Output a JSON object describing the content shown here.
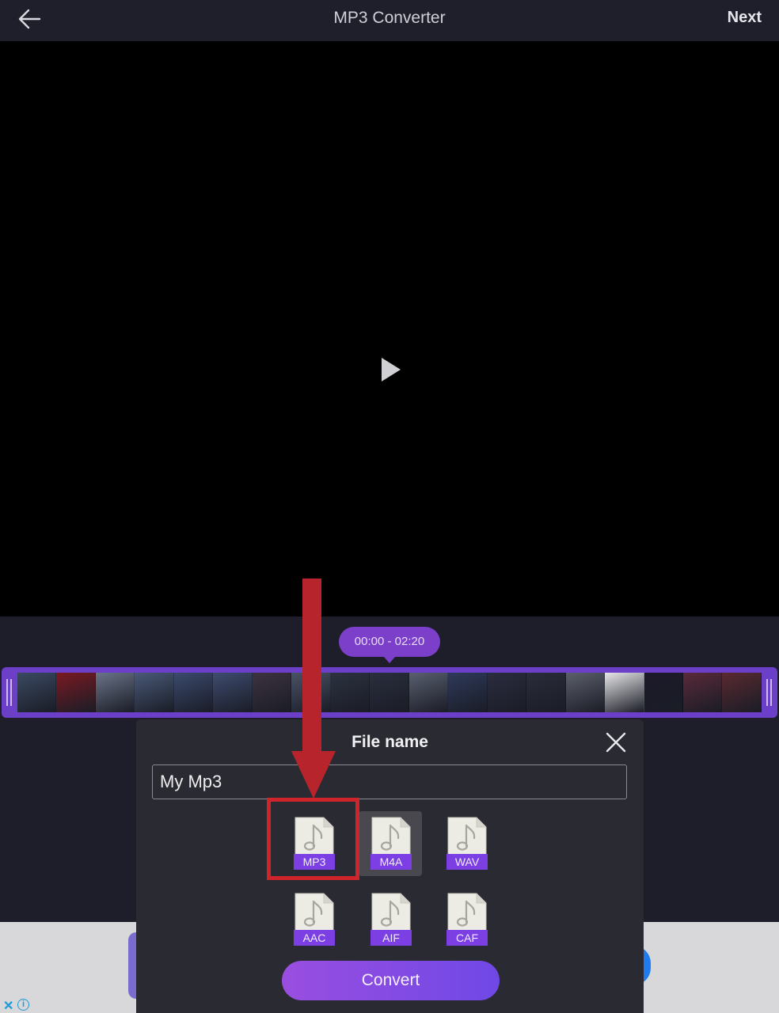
{
  "header": {
    "back_icon": "back-arrow-icon",
    "title": "MP3 Converter",
    "next_label": "Next"
  },
  "video": {
    "play_icon": "play-icon"
  },
  "timeline": {
    "range_label": "00:00 - 02:20",
    "frame_colors": [
      "#3a4a62",
      "#7a1a22",
      "#6a7488",
      "#4a5a78",
      "#3b4a6e",
      "#3e4c70",
      "#3d3340",
      "#4a5266",
      "#2c3240",
      "#2a2f3e",
      "#5a6070",
      "#2e3a5a",
      "#2b2d40",
      "#2a2c3a",
      "#5c606a",
      "#e7e7e9",
      "#1c1a2a",
      "#5a2a3a",
      "#5a2a30"
    ],
    "accent": "#6b3fc8"
  },
  "dialog": {
    "title": "File name",
    "close_icon": "close-icon",
    "file_name_value": "My Mp3",
    "formats": [
      {
        "label": "MP3",
        "selected": false
      },
      {
        "label": "M4A",
        "selected": true
      },
      {
        "label": "WAV",
        "selected": false
      },
      {
        "label": "AAC",
        "selected": false
      },
      {
        "label": "AIF",
        "selected": false
      },
      {
        "label": "CAF",
        "selected": false
      }
    ],
    "format_icon": "music-file-icon",
    "convert_label": "Convert"
  },
  "ad": {
    "close_label": "✕",
    "info_label": "i"
  },
  "annotation": {
    "color": "#d0242b"
  }
}
